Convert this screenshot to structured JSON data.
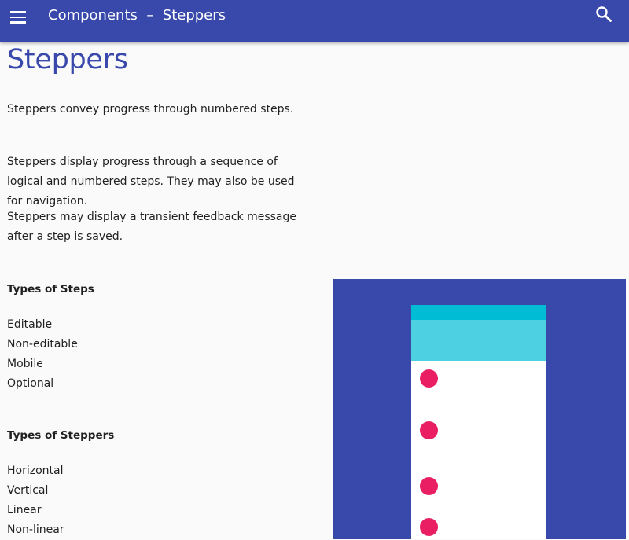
{
  "appbar": {
    "title": "Components  –  Steppers",
    "menu_icon": "menu-icon",
    "search_icon": "search-icon",
    "color": "#3949ab"
  },
  "page": {
    "title": "Steppers",
    "intro": "Steppers convey progress through numbered steps.",
    "paragraphs": [
      "Steppers display progress through a sequence of logical and numbered steps. They may also be used for navigation.",
      "Steppers may display a transient feedback message after a step is saved."
    ]
  },
  "types_of_steps": {
    "heading": "Types of Steps",
    "items": [
      "Editable",
      "Non-editable",
      "Mobile",
      "Optional"
    ]
  },
  "types_of_steppers": {
    "heading": "Types of Steppers",
    "items": [
      "Horizontal",
      "Vertical",
      "Linear",
      "Non-linear"
    ]
  },
  "illustration": {
    "background": "#3949ab",
    "status_bar_color": "#00bcd4",
    "toolbar_color": "#4dd0e1",
    "step_color": "#e91e63",
    "step_count": 4
  }
}
